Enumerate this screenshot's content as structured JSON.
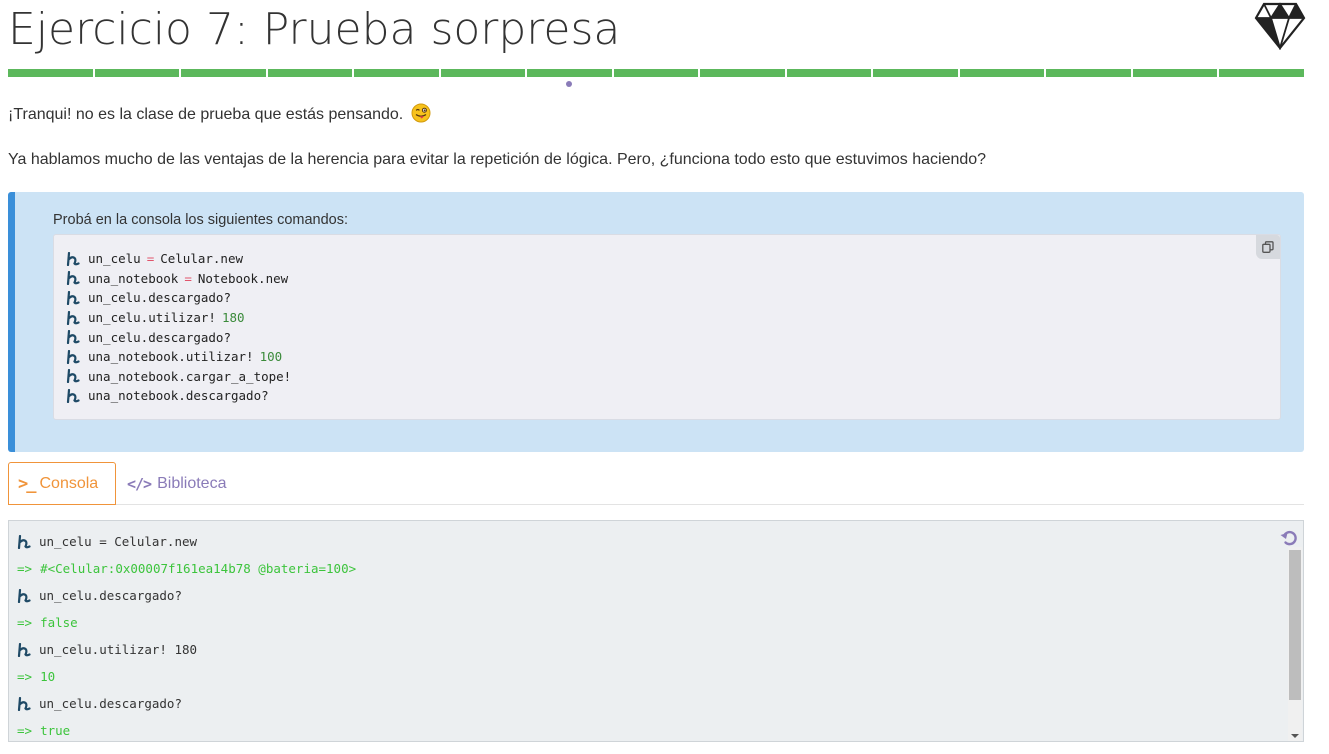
{
  "header": {
    "title": "Ejercicio 7: Prueba sorpresa"
  },
  "progress": {
    "segments": 15,
    "completed": 15,
    "current_index": 6
  },
  "intro": {
    "line1": "¡Tranqui! no es la clase de prueba que estás pensando.",
    "line1_emoji": "winking-tongue-face",
    "line2": "Ya hablamos mucho de las ventajas de la herencia para evitar la repetición de lógica. Pero, ¿funciona todo esto que estuvimos haciendo?"
  },
  "callout": {
    "lead": "Probá en la consola los siguientes comandos:",
    "copy_icon": "copy-icon",
    "lines": [
      {
        "a": "un_celu",
        "op": "=",
        "b": "Celular.new",
        "num": ""
      },
      {
        "a": "una_notebook",
        "op": "=",
        "b": "Notebook.new",
        "num": ""
      },
      {
        "a": "un_celu.descargado?",
        "op": "",
        "b": "",
        "num": ""
      },
      {
        "a": "un_celu.utilizar!",
        "op": "",
        "b": "",
        "num": "180"
      },
      {
        "a": "un_celu.descargado?",
        "op": "",
        "b": "",
        "num": ""
      },
      {
        "a": "una_notebook.utilizar!",
        "op": "",
        "b": "",
        "num": "100"
      },
      {
        "a": "una_notebook.cargar_a_tope!",
        "op": "",
        "b": "",
        "num": ""
      },
      {
        "a": "una_notebook.descargado?",
        "op": "",
        "b": "",
        "num": ""
      }
    ]
  },
  "tabs": {
    "console_label": "Consola",
    "library_label": "Biblioteca",
    "active": "Consola"
  },
  "console": {
    "reset_icon": "reset-icon",
    "entries": [
      {
        "type": "in",
        "text": "un_celu = Celular.new"
      },
      {
        "type": "out",
        "arrow": "=>",
        "text": "#<Celular:0x00007f161ea14b78 @bateria=100>"
      },
      {
        "type": "in",
        "text": "un_celu.descargado?"
      },
      {
        "type": "out",
        "arrow": "=>",
        "text": "false"
      },
      {
        "type": "in",
        "text": "un_celu.utilizar! 180"
      },
      {
        "type": "out",
        "arrow": "=>",
        "text": "10"
      },
      {
        "type": "in",
        "text": "un_celu.descargado?"
      },
      {
        "type": "out",
        "arrow": "=>",
        "text": "true"
      }
    ]
  },
  "colors": {
    "progress": "#5cb85c",
    "callout_bg": "#cce3f5",
    "callout_border": "#3a8fd9",
    "tab_active": "#f0943a",
    "tab_inactive": "#8a7bb8",
    "console_output": "#3cc43c"
  }
}
